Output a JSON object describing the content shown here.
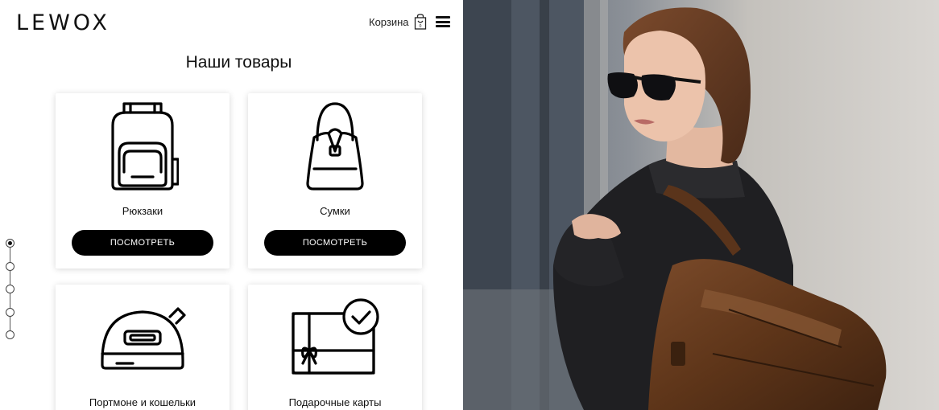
{
  "header": {
    "logo": "LEWOX",
    "cart_label": "Корзина",
    "cart_icon": "shopping-bag-icon",
    "menu_icon": "hamburger-menu-icon"
  },
  "main": {
    "title": "Наши товары",
    "cards": [
      {
        "icon": "backpack-icon",
        "title": "Рюкзаки",
        "button": "ПОСМОТРЕТЬ"
      },
      {
        "icon": "handbag-icon",
        "title": "Сумки",
        "button": "ПОСМОТРЕТЬ"
      },
      {
        "icon": "wallet-icon",
        "title": "Портмоне и кошельки"
      },
      {
        "icon": "gift-card-icon",
        "title": "Подарочные карты"
      }
    ]
  },
  "pager": {
    "count": 5,
    "active_index": 0
  },
  "hero_image": {
    "subject": "woman-with-leather-backpack-photo"
  },
  "colors": {
    "accent": "#000000",
    "background": "#ffffff"
  }
}
